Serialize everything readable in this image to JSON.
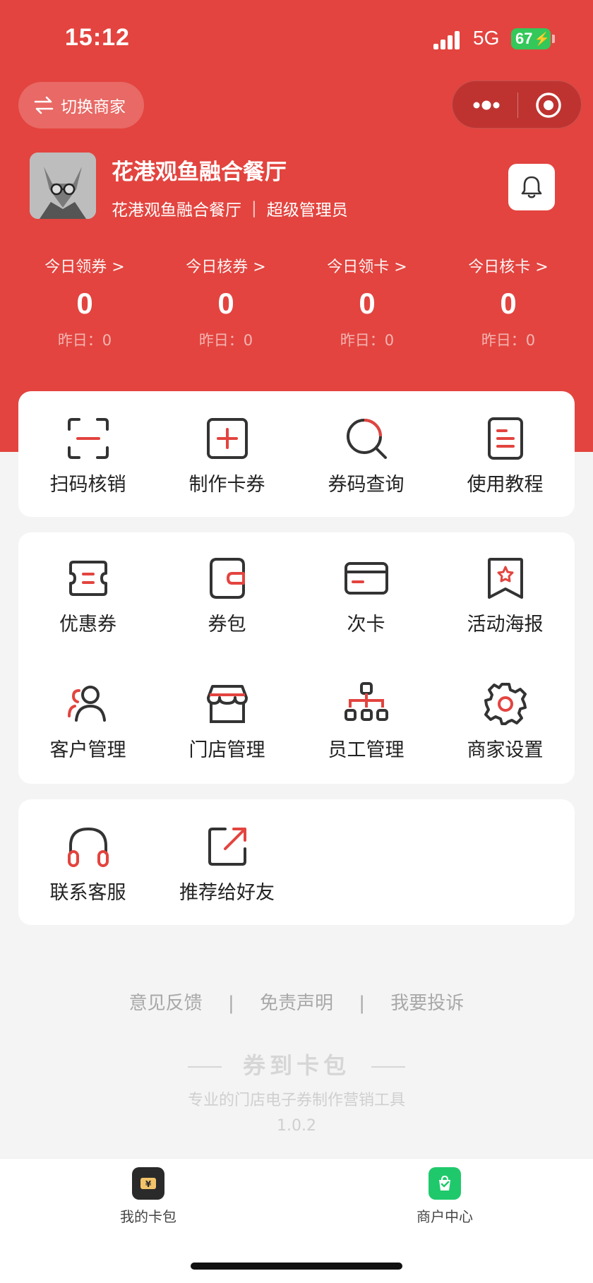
{
  "status_bar": {
    "time": "15:12",
    "network": "5G",
    "battery": "67"
  },
  "header": {
    "switch_label": "切换商家",
    "merchant_name": "花港观鱼融合餐厅",
    "merchant_sub": "花港观鱼融合餐厅",
    "separator": "|",
    "role": "超级管理员"
  },
  "stats": [
    {
      "label": "今日领券 >",
      "value": "0",
      "yesterday": "昨日：0"
    },
    {
      "label": "今日核券 >",
      "value": "0",
      "yesterday": "昨日：0"
    },
    {
      "label": "今日领卡 >",
      "value": "0",
      "yesterday": "昨日：0"
    },
    {
      "label": "今日核卡 >",
      "value": "0",
      "yesterday": "昨日：0"
    }
  ],
  "quick_actions": [
    {
      "label": "扫码核销",
      "icon": "scan-icon"
    },
    {
      "label": "制作卡券",
      "icon": "add-square-icon"
    },
    {
      "label": "券码查询",
      "icon": "search-icon"
    },
    {
      "label": "使用教程",
      "icon": "document-icon"
    }
  ],
  "manage": [
    {
      "label": "优惠券",
      "icon": "coupon-icon"
    },
    {
      "label": "券包",
      "icon": "wallet-icon"
    },
    {
      "label": "次卡",
      "icon": "card-icon"
    },
    {
      "label": "活动海报",
      "icon": "poster-icon"
    },
    {
      "label": "客户管理",
      "icon": "customers-icon"
    },
    {
      "label": "门店管理",
      "icon": "store-icon"
    },
    {
      "label": "员工管理",
      "icon": "org-chart-icon"
    },
    {
      "label": "商家设置",
      "icon": "gear-icon"
    }
  ],
  "extra": [
    {
      "label": "联系客服",
      "icon": "headset-icon"
    },
    {
      "label": "推荐给好友",
      "icon": "share-icon"
    }
  ],
  "footer": {
    "links": [
      "意见反馈",
      "|",
      "免责声明",
      "|",
      "我要投诉"
    ],
    "brand": "券到卡包",
    "tagline": "专业的门店电子券制作营销工具",
    "version": "1.0.2"
  },
  "tabbar": [
    {
      "label": "我的卡包",
      "icon": "yen-card-icon"
    },
    {
      "label": "商户中心",
      "icon": "shop-bag-icon"
    }
  ],
  "colors": {
    "accent": "#e3443f",
    "tab_left": "#2a2a2a",
    "tab_right": "#1fc96b"
  }
}
